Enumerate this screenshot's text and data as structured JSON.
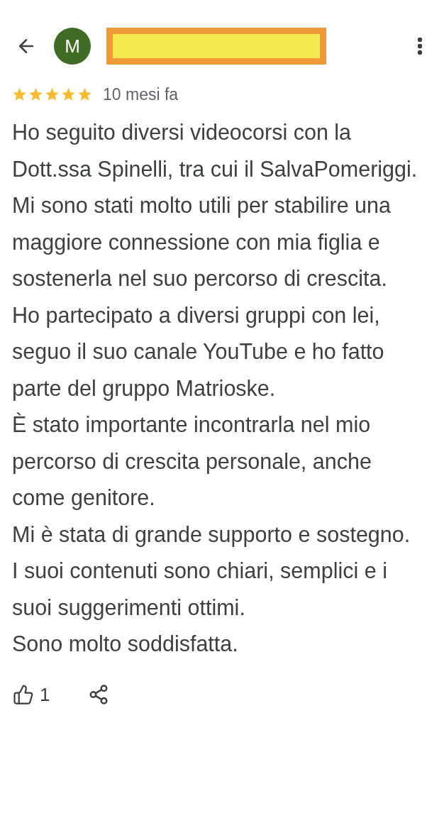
{
  "reviewer": {
    "initial": "M"
  },
  "review": {
    "stars": 5,
    "time": "10 mesi fa",
    "paragraphs": [
      "Ho seguito diversi videocorsi con la Dott.ssa Spinelli, tra cui il SalvaPomeriggi.",
      "Mi sono stati molto utili per stabilire una maggiore connessione con mia figlia e sostenerla nel suo percorso di crescita.",
      "Ho partecipato a diversi gruppi con lei, seguo il suo canale YouTube e ho fatto parte del gruppo Matrioske.",
      "È stato importante incontrarla nel mio percorso di crescita personale, anche come genitore.",
      "Mi è stata di grande supporto e sostegno.",
      "I suoi contenuti sono chiari, semplici e i suoi suggerimenti ottimi.",
      "Sono molto soddisfatta."
    ]
  },
  "actions": {
    "likes": "1"
  }
}
